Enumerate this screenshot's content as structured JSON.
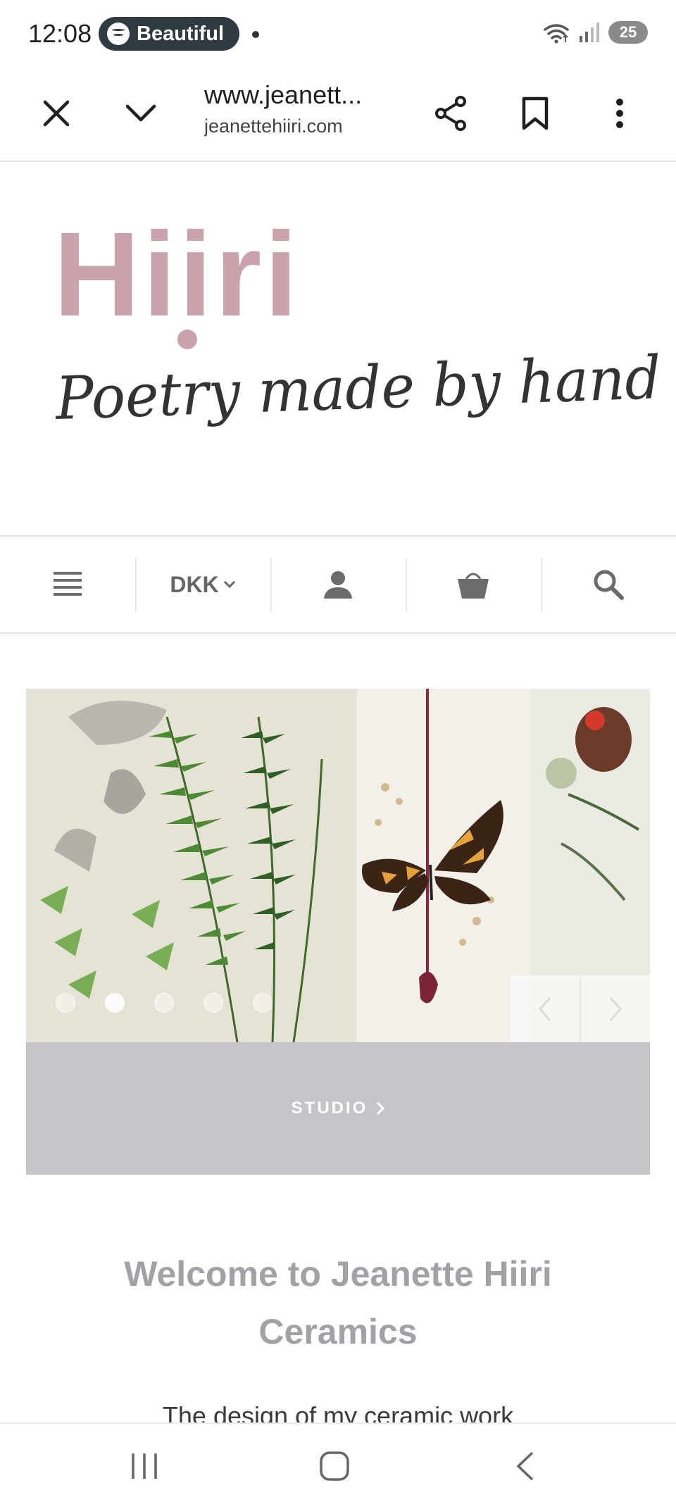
{
  "status_bar": {
    "time": "12:08",
    "media_label": "Beautiful",
    "battery": "25"
  },
  "browser": {
    "url_title": "www.jeanett...",
    "url_subtitle": "jeanettehiiri.com",
    "icons": [
      "close-icon",
      "chevron-down-icon",
      "share-icon",
      "bookmark-icon",
      "more-vert-icon"
    ]
  },
  "header": {
    "logo_text": "Hiiri",
    "tagline": "Poetry made by hand",
    "logo_color": "#c9a2ab"
  },
  "shop_nav": {
    "currency": "DKK",
    "icons": [
      "menu-icon",
      "user-icon",
      "basket-icon",
      "search-icon"
    ]
  },
  "slider": {
    "slide_count": 5,
    "active_slide": 1,
    "caption": "STUDIO"
  },
  "content": {
    "welcome_line1": "Welcome to Jeanette Hiiri",
    "welcome_line2": "Ceramics",
    "intro_text": "The design of my ceramic work"
  },
  "colors": {
    "accent_heading": "#a2a2a6",
    "caption_bar": "#c4c5c9",
    "pill_bg": "#2f3b40"
  }
}
